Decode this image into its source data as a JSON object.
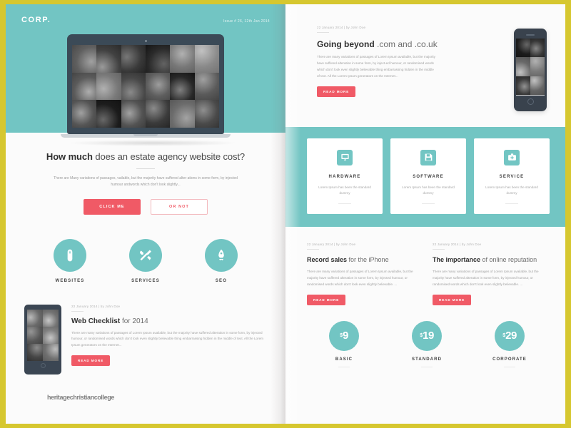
{
  "theme": {
    "frame_gold": "#d6c72f",
    "teal": "#72c5c3",
    "coral": "#f05a66",
    "paper": "#fbfbfb",
    "dark_device": "#3b4a57"
  },
  "left_page": {
    "logo": "CORP.",
    "issue": "Issue # 26, 12th Jan 2014",
    "hero_device": "laptop-mockup",
    "headline": {
      "strong": "How much",
      "rest": " does an estate agency website cost?"
    },
    "lede": "There are Many variations of passages, vailable, but the majority have suffered alter-ations in some form, by injected humour andwords which don't look slightly...",
    "buttons": {
      "primary": "CLICK ME",
      "secondary": "OR NOT"
    },
    "services": [
      {
        "label": "WEBSITES",
        "icon": "mouse-icon"
      },
      {
        "label": "SERVICES",
        "icon": "tools-icon"
      },
      {
        "label": "SEO",
        "icon": "rocket-icon"
      }
    ],
    "article": {
      "meta": "22 January 2014  |  by John Doe",
      "title_strong": "Web Checklist",
      "title_rest": " for 2014",
      "body": "There are many variations of passages of Lorem Ipsum available, but the majority have suffered alteration in some form, by injected humour, or randomised words which don't look even slightly believable thing embarrassing hidden in the middle of text. All the Lorem Ipsum generators on the Internet...",
      "read_more": "READ MORE"
    },
    "watermark": "heritagechristiancollege"
  },
  "right_page": {
    "feature": {
      "meta": "22 January 2014  |  by John Doe",
      "title_strong": "Going beyond",
      "title_rest": " .com and .co.uk",
      "body": "There are many variations of passages of Lorem Ipsum available, but the majority have suffered alteration in some form, by inject-ed humour, or randomised words which don't look even slightly believable thing embarrassing hidden in the middle of text. All the Lorem Ipsum generators on the Internet...",
      "read_more": "READ MORE",
      "device": "iphone-mockup"
    },
    "cards": [
      {
        "title": "HARDWARE",
        "text": "Lorem Ipsum has been the standard dummy",
        "icon": "monitor-icon"
      },
      {
        "title": "SOFTWARE",
        "text": "Lorem Ipsum has been the standard dummy",
        "icon": "save-icon"
      },
      {
        "title": "SERVICE",
        "text": "Lorem Ipsum has been the standard dummy",
        "icon": "medkit-icon"
      }
    ],
    "articles": [
      {
        "meta": "22 January 2014  |  by John Doe",
        "title_strong": "Record sales",
        "title_rest": " for the iPhone",
        "body": "There are many variations of passages of Lorem Ipsum available, but the majority have suffered alteration in some form, by injected humour, or randomised words which don't look even slightly believable. ...",
        "read_more": "READ MORE"
      },
      {
        "meta": "22 January 2014  |  by John Doe",
        "title_strong": "The importance",
        "title_rest": " of online reputation",
        "body": "There are many variations of passages of Lorem Ipsum available, but the majority have suffered alteration in some form, by injected humour, or randomised words which don't look even slightly believable. ...",
        "read_more": "READ MORE"
      }
    ],
    "pricing": [
      {
        "currency": "$",
        "amount": "9",
        "label": "BASIC"
      },
      {
        "currency": "$",
        "amount": "19",
        "label": "STANDARD"
      },
      {
        "currency": "$",
        "amount": "29",
        "label": "CORPORATE"
      }
    ]
  }
}
